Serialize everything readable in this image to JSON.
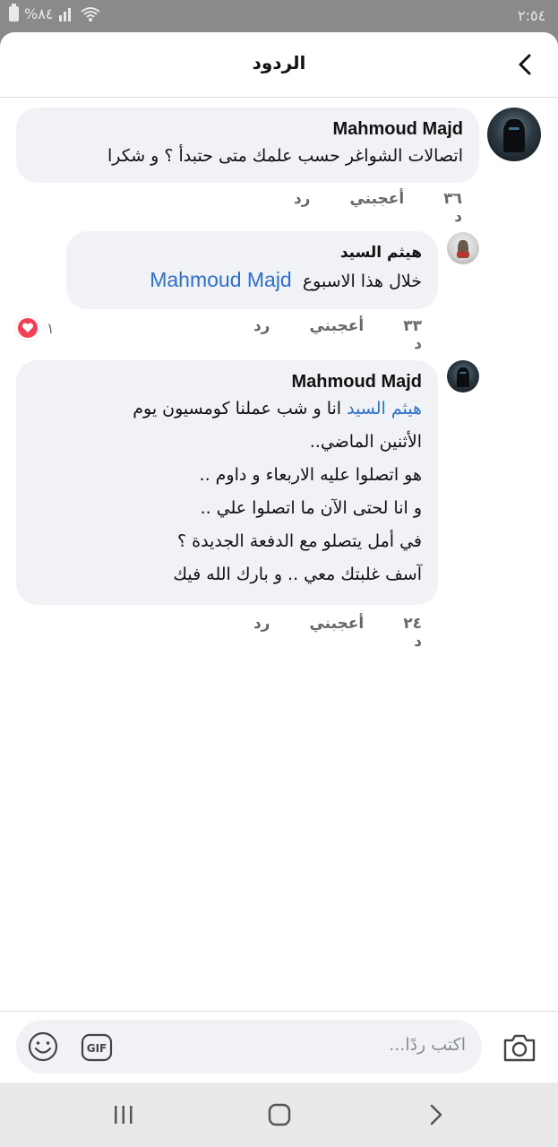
{
  "status": {
    "time": "٢:٥٤",
    "battery": "%٨٤",
    "icons": [
      "battery-icon",
      "signal-icon",
      "wifi-icon"
    ]
  },
  "header": {
    "title": "الردود",
    "back_icon": "chevron-left-icon"
  },
  "comments": [
    {
      "author": "Mahmoud Majd",
      "text": "اتصالات الشواغر حسب علمك متى حتبدأ ؟ و شكرا",
      "time": "٣٦ د",
      "like_label": "أعجبني",
      "reply_label": "رد"
    },
    {
      "author": "هيثم السيد",
      "mention": "Mahmoud Majd",
      "text": "خلال هذا الاسبوع",
      "time": "٣٣ د",
      "like_label": "أعجبني",
      "reply_label": "رد",
      "reaction_count": "١",
      "reaction_icon": "heart-icon"
    },
    {
      "author": "Mahmoud Majd",
      "mention": "هيثم السيد",
      "line1": "انا و شب  عملنا كومسيون يوم",
      "line2": "الأثنين الماضي..",
      "line3": "هو اتصلوا عليه الاربعاء و داوم ..",
      "line4": "و انا لحتى الآن ما اتصلوا علي ..",
      "line5": "في أمل يتصلو مع الدفعة الجديدة ؟",
      "line6": "آسف غلبتك معي .. و بارك الله فيك",
      "time": "٢٤ د",
      "like_label": "أعجبني",
      "reply_label": "رد"
    }
  ],
  "composer": {
    "placeholder": "اكتب ردًا...",
    "icons": [
      "emoji-icon",
      "gif-icon",
      "camera-icon"
    ]
  },
  "nav": {
    "icons": [
      "recent-apps-icon",
      "home-icon",
      "back-icon"
    ]
  },
  "colors": {
    "mention": "#2d6fd0",
    "bubble": "#f0f2f5",
    "heart": "#f33e58",
    "meta": "#65676b"
  }
}
